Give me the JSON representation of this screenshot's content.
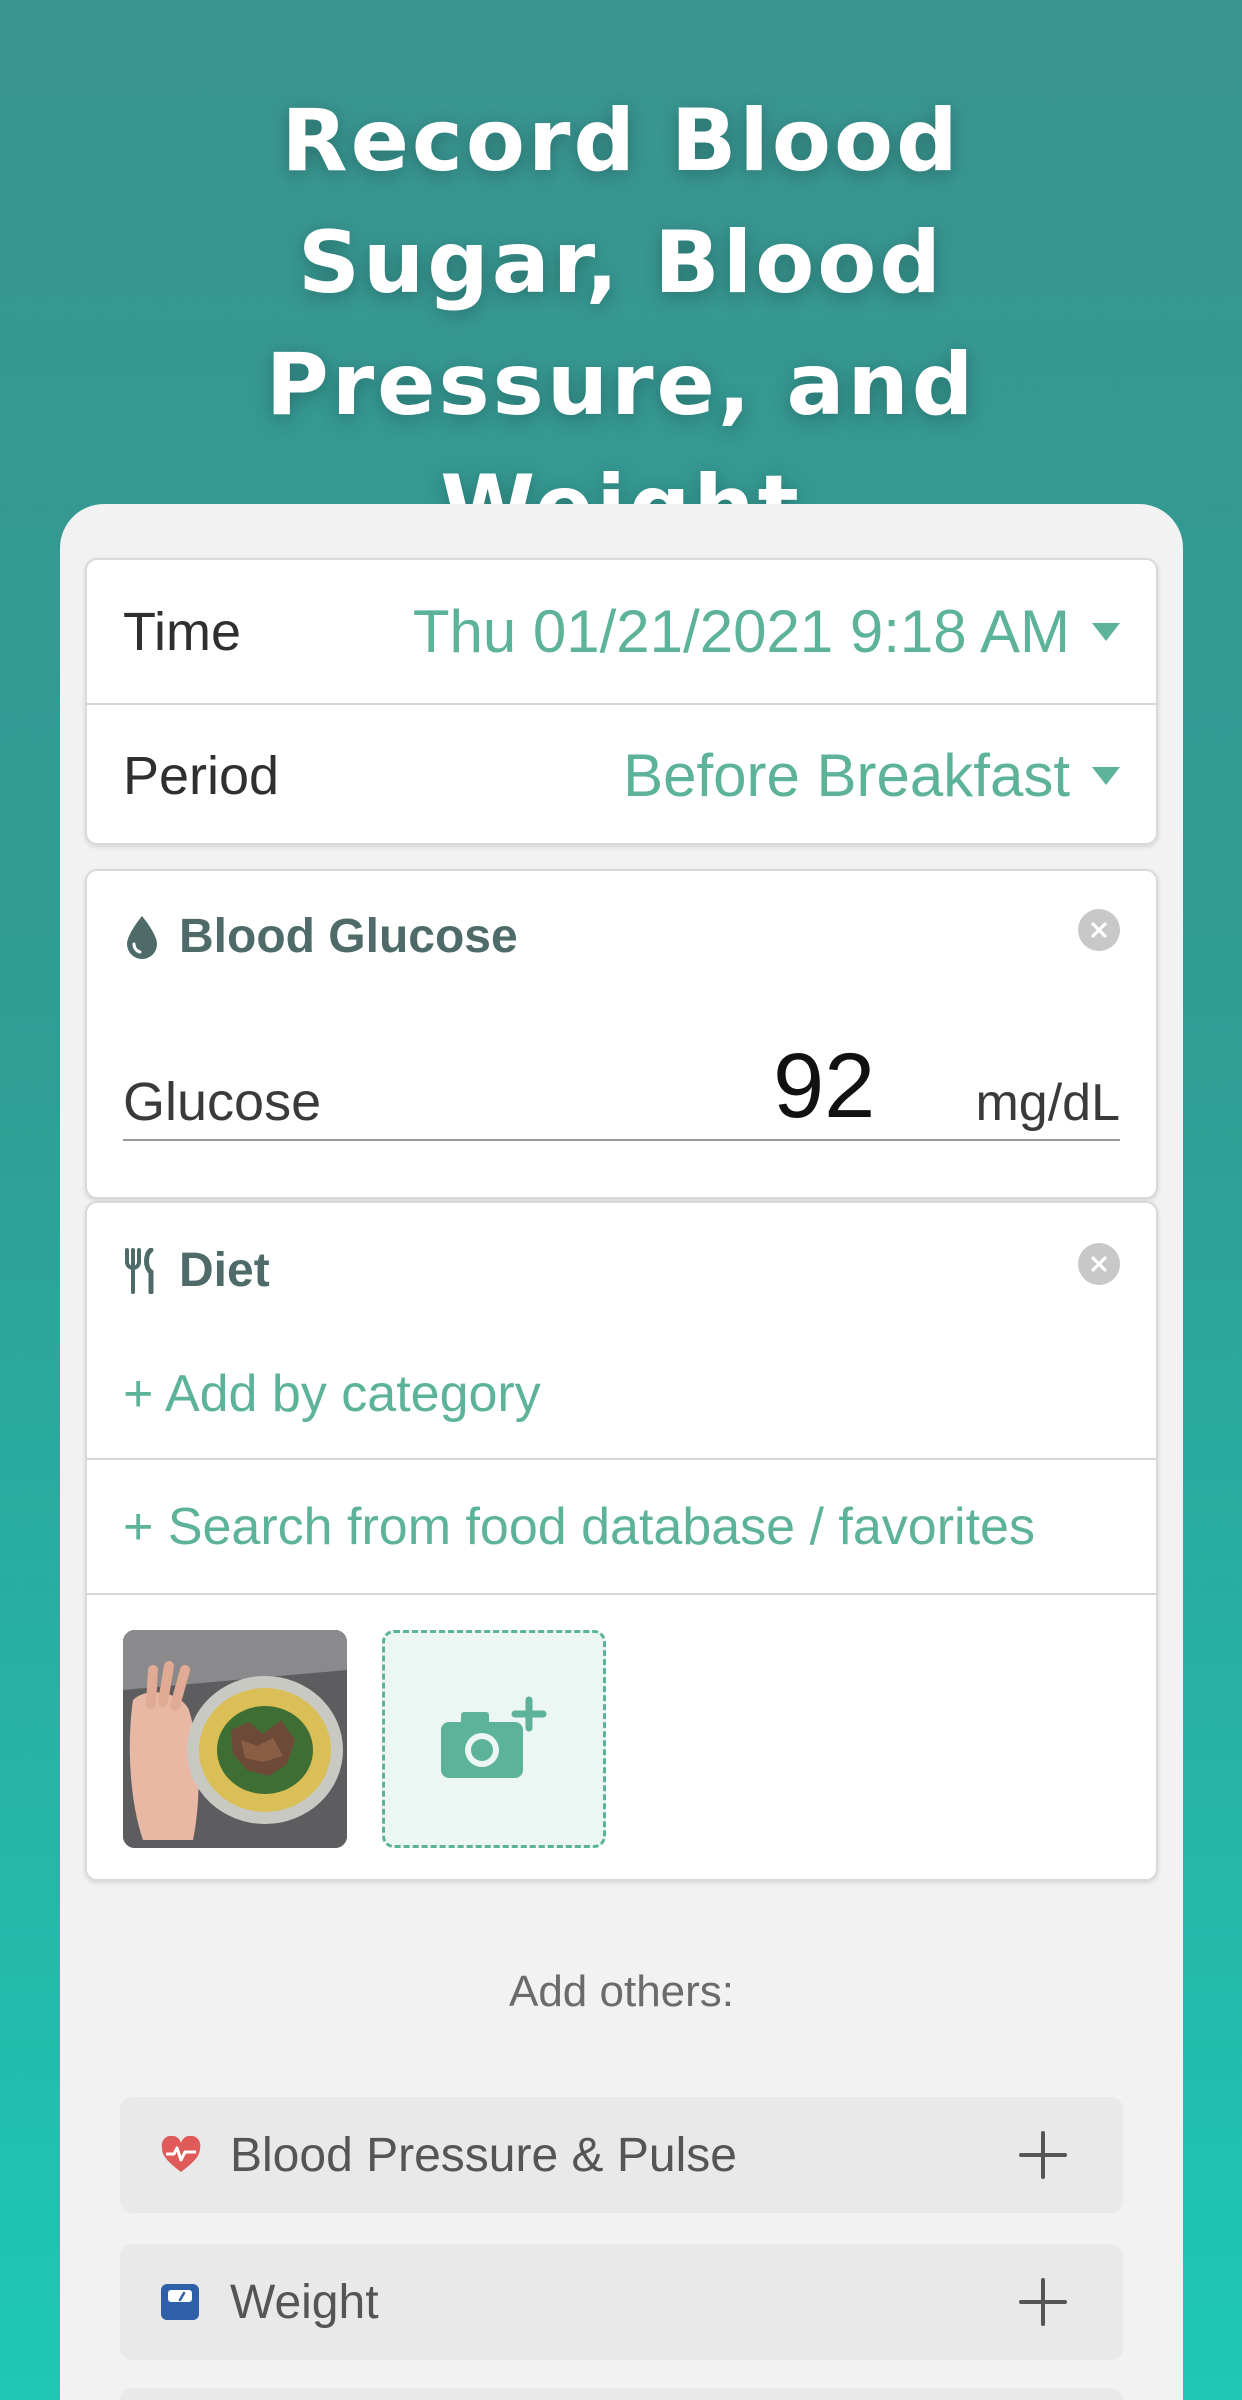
{
  "headline": "Record Blood Sugar, Blood Pressure, and Weight",
  "entry": {
    "time_label": "Time",
    "time_value": "Thu 01/21/2021 9:18 AM",
    "period_label": "Period",
    "period_value": "Before Breakfast"
  },
  "blood_glucose": {
    "title": "Blood Glucose",
    "field_label": "Glucose",
    "value": "92",
    "unit": "mg/dL",
    "icon": "water-drop-icon"
  },
  "diet": {
    "title": "Diet",
    "icon": "fork-knife-icon",
    "add_by_category": "+ Add by category",
    "search_database": "+ Search from food database / favorites",
    "add_photo_icon": "camera-plus-icon"
  },
  "add_others": {
    "title": "Add others:",
    "items": [
      {
        "label": "Blood Pressure & Pulse",
        "icon": "heart-pulse-icon"
      },
      {
        "label": "Weight",
        "icon": "scale-icon"
      }
    ]
  },
  "colors": {
    "accent": "#5db39a",
    "header_top": "#3a9490",
    "header_bottom": "#1ec8b5",
    "heart": "#e05a5a",
    "scale": "#2f5fa8"
  }
}
